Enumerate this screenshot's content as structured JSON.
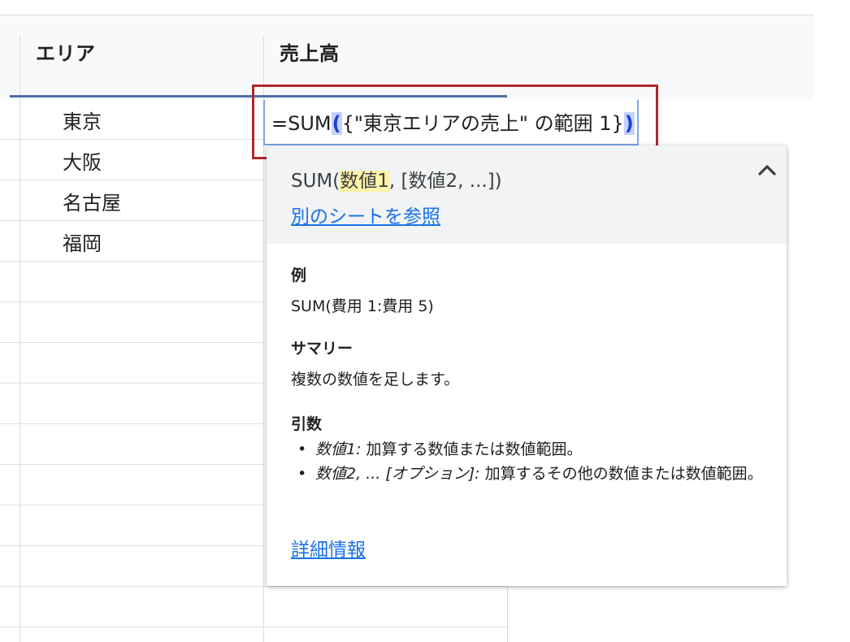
{
  "sheet": {
    "columns": [
      "エリア",
      "売上高"
    ],
    "rows": [
      "東京",
      "大阪",
      "名古屋",
      "福岡"
    ]
  },
  "formula": {
    "prefix": "=SUM",
    "open": "(",
    "inner": "{\"東京エリアの売上\" の範囲 1}",
    "close": ")"
  },
  "tooltip": {
    "signature_pre": "SUM(",
    "signature_hl": "数値1",
    "signature_post": ", [数値2, ...])",
    "other_sheet_link": "別のシートを参照",
    "example_title": "例",
    "example_body": "SUM(費用 1:費用 5)",
    "summary_title": "サマリー",
    "summary_body": "複数の数値を足します。",
    "args_title": "引数",
    "arg1_name": "数値1:",
    "arg1_desc": " 加算する数値または数値範囲。",
    "arg2_name": "数値2, ... [オプション]:",
    "arg2_desc": " 加算するその他の数値または数値範囲。",
    "more_link": "詳細情報",
    "collapse_icon": "chevron-up-icon"
  },
  "colors": {
    "highlight_border": "#b0262b",
    "link": "#1a73e8",
    "cell_border": "#7aa7e8",
    "paren_bg": "#c5d2fb"
  }
}
